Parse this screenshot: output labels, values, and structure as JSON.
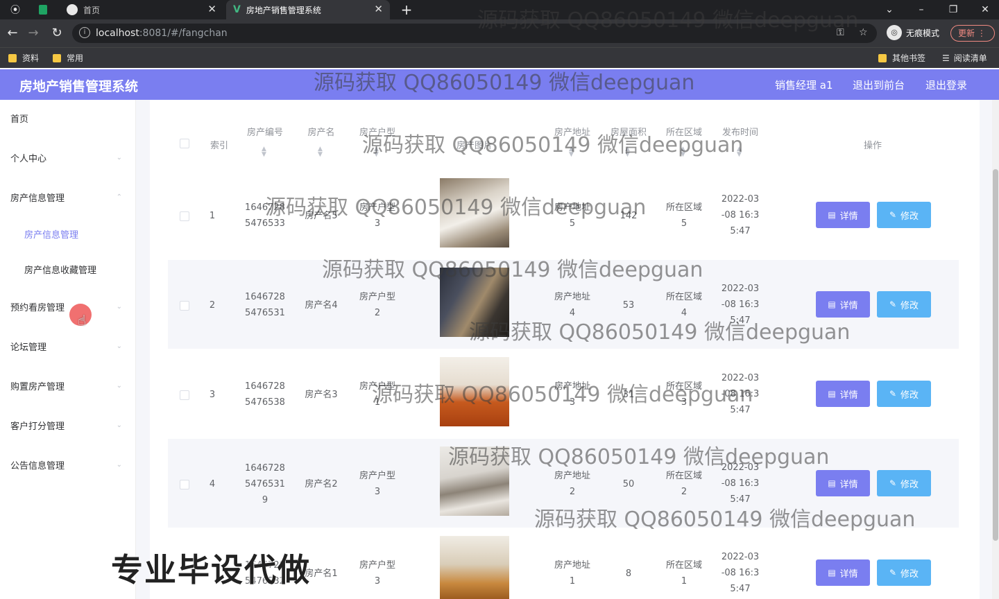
{
  "browser": {
    "tabs": [
      {
        "label": "首页",
        "icon": "globe-icon"
      },
      {
        "label": "房地产销售管理系统",
        "icon": "vue-icon"
      }
    ],
    "url_host": "localhost",
    "url_rest": ":8081/#/fangchan",
    "incognito_label": "无痕模式",
    "update_label": "更新",
    "bookmarks": [
      "资料",
      "常用"
    ],
    "other_bookmarks": "其他书签",
    "reading_list": "阅读清单"
  },
  "header": {
    "title": "房地产销售管理系统",
    "user": "销售经理 a1",
    "to_front": "退出到前台",
    "logout": "退出登录"
  },
  "sidebar": {
    "items": [
      {
        "label": "首页"
      },
      {
        "label": "个人中心"
      },
      {
        "label": "房产信息管理"
      },
      {
        "label": "房产信息管理"
      },
      {
        "label": "房产信息收藏管理"
      },
      {
        "label": "预约看房管理"
      },
      {
        "label": "论坛管理"
      },
      {
        "label": "购置房产管理"
      },
      {
        "label": "客户打分管理"
      },
      {
        "label": "公告信息管理"
      }
    ]
  },
  "table": {
    "columns": {
      "index": "索引",
      "code": "房产编号",
      "name": "房产名",
      "type": "房产户型",
      "image": "房产图片",
      "address": "房产地址",
      "area": "房屋面积",
      "region": "所在区域",
      "time": "发布时间",
      "ops": "操作"
    },
    "rows": [
      {
        "index": "1",
        "code1": "1646728",
        "code2": "5476533",
        "code3": "",
        "name": "房产名5",
        "type1": "房产户型",
        "type2": "3",
        "addr1": "房产地址",
        "addr2": "5",
        "area": "142",
        "region1": "所在区域",
        "region2": "5",
        "t1": "2022-03",
        "t2": "-08 16:3",
        "t3": "5:47"
      },
      {
        "index": "2",
        "code1": "1646728",
        "code2": "5476531",
        "code3": "",
        "name": "房产名4",
        "type1": "房产户型",
        "type2": "2",
        "addr1": "房产地址",
        "addr2": "4",
        "area": "53",
        "region1": "所在区域",
        "region2": "4",
        "t1": "2022-03",
        "t2": "-08 16:3",
        "t3": "5:47"
      },
      {
        "index": "3",
        "code1": "1646728",
        "code2": "5476538",
        "code3": "",
        "name": "房产名3",
        "type1": "房产户型",
        "type2": "1",
        "addr1": "房产地址",
        "addr2": "3",
        "area": "31",
        "region1": "所在区域",
        "region2": "3",
        "t1": "2022-03",
        "t2": "-08 16:3",
        "t3": "5:47"
      },
      {
        "index": "4",
        "code1": "1646728",
        "code2": "5476531",
        "code3": "9",
        "name": "房产名2",
        "type1": "房产户型",
        "type2": "3",
        "addr1": "房产地址",
        "addr2": "2",
        "area": "50",
        "region1": "所在区域",
        "region2": "2",
        "t1": "2022-03",
        "t2": "-08 16:3",
        "t3": "5:47"
      },
      {
        "index": "",
        "code1": "1646728",
        "code2": "5476532",
        "code3": "",
        "name": "房产名1",
        "type1": "房产户型",
        "type2": "3",
        "addr1": "房产地址",
        "addr2": "1",
        "area": "8",
        "region1": "所在区域",
        "region2": "1",
        "t1": "2022-03",
        "t2": "-08 16:3",
        "t3": "5:47"
      }
    ],
    "detail_label": "详情",
    "edit_label": "修改"
  },
  "watermark": "源码获取 QQ86050149 微信deepguan",
  "banner": "专业毕设代做",
  "colors": {
    "accent": "#7a7ef0",
    "edit": "#5ab4f5"
  }
}
